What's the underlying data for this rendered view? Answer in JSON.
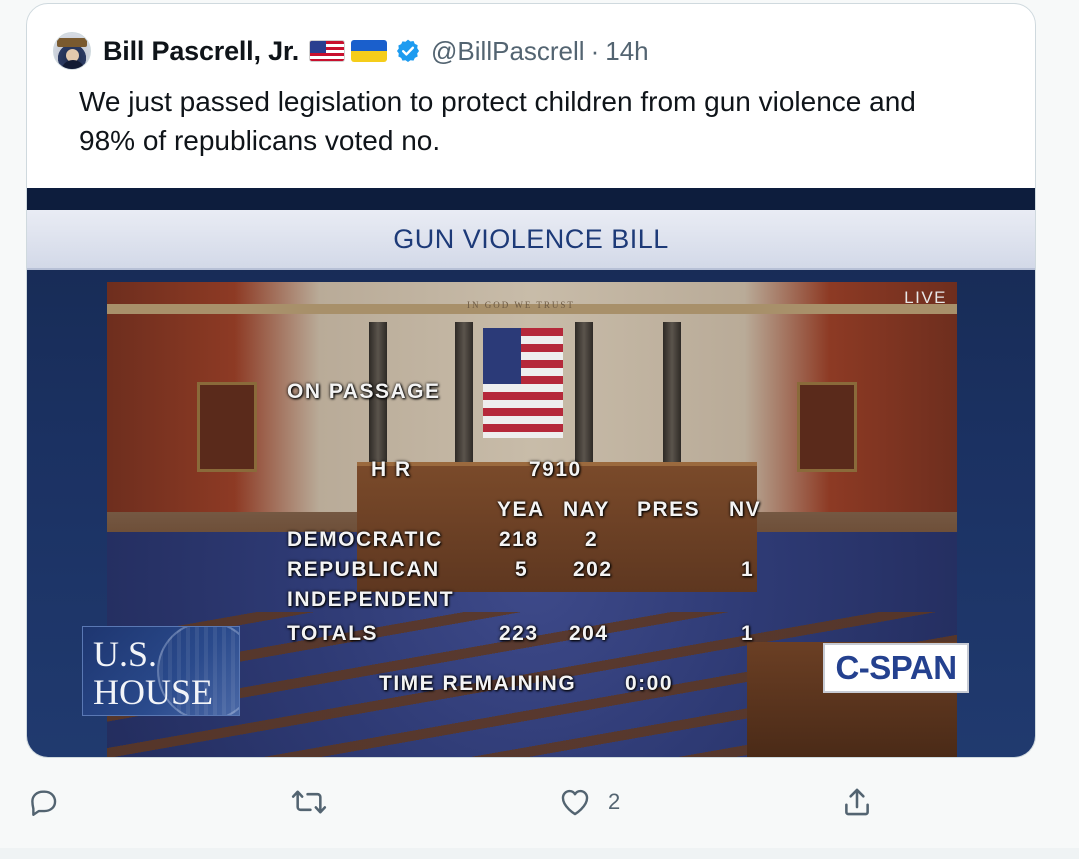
{
  "tweet": {
    "author_name": "Bill Pascrell, Jr.",
    "handle": "@BillPascrell",
    "separator": "·",
    "time": "14h",
    "text": "We just passed legislation to protect children from gun violence and\n98% of republicans voted no."
  },
  "media": {
    "banner_title": "GUN VIOLENCE BILL",
    "live_label": "LIVE",
    "vote_board": {
      "heading": "ON PASSAGE",
      "bill_prefix": "H R",
      "bill_number": "7910",
      "columns": [
        "YEA",
        "NAY",
        "PRES",
        "NV"
      ],
      "rows": [
        {
          "party": "DEMOCRATIC",
          "yea": "218",
          "nay": "2",
          "pres": "",
          "nv": ""
        },
        {
          "party": "REPUBLICAN",
          "yea": "5",
          "nay": "202",
          "pres": "",
          "nv": "1"
        },
        {
          "party": "INDEPENDENT",
          "yea": "",
          "nay": "",
          "pres": "",
          "nv": ""
        },
        {
          "party": "TOTALS",
          "yea": "223",
          "nay": "204",
          "pres": "",
          "nv": "1"
        }
      ],
      "time_label": "TIME REMAINING",
      "time_value": "0:00"
    },
    "house_logo": {
      "line1": "U.S.",
      "line2": "HOUSE"
    },
    "network_logo": "C-SPAN",
    "scene_motto": "IN GOD WE TRUST"
  },
  "actions": {
    "reply_icon": "reply-icon",
    "retweet_icon": "retweet-icon",
    "like_icon": "heart-icon",
    "like_count": "2",
    "share_icon": "share-icon"
  },
  "colors": {
    "verified_blue": "#1d9bf0",
    "muted_text": "#536471",
    "banner_text": "#1d3a78"
  }
}
